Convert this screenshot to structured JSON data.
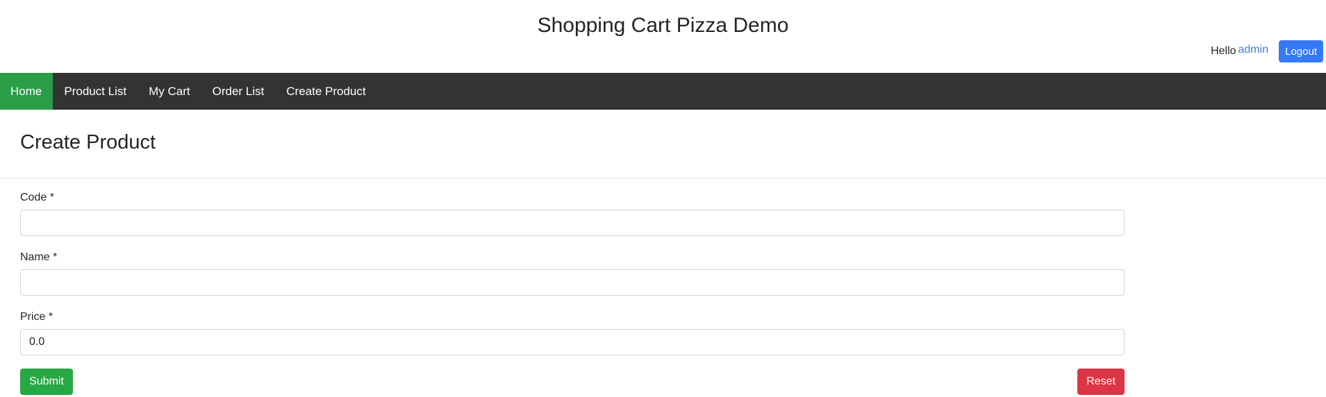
{
  "header": {
    "title": "Shopping Cart Pizza Demo",
    "greeting": "Hello",
    "username": "admin",
    "logout_label": "Logout"
  },
  "nav": {
    "items": [
      {
        "label": "Home",
        "active": true
      },
      {
        "label": "Product List"
      },
      {
        "label": "My Cart"
      },
      {
        "label": "Order List"
      },
      {
        "label": "Create Product"
      }
    ]
  },
  "page": {
    "title": "Create Product"
  },
  "form": {
    "code": {
      "label": "Code *",
      "value": ""
    },
    "name": {
      "label": "Name *",
      "value": ""
    },
    "price": {
      "label": "Price *",
      "value": "0.0"
    },
    "submit_label": "Submit",
    "reset_label": "Reset"
  },
  "colors": {
    "nav_bg": "#333333",
    "nav_active": "#2a9d47",
    "primary": "#3579f6",
    "success": "#28a745",
    "danger": "#dc3545"
  }
}
